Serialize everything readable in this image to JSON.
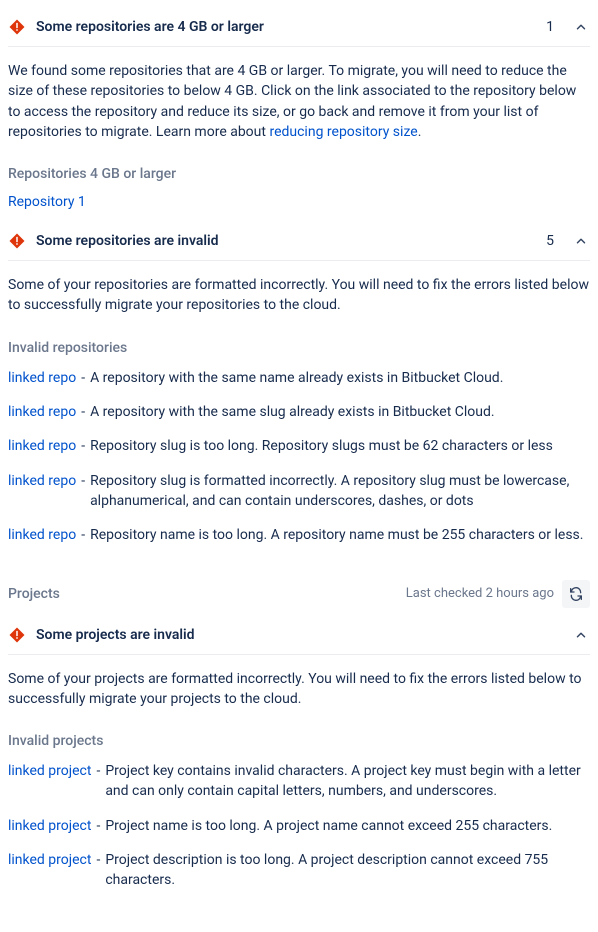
{
  "panel1": {
    "title": "Some repositories are 4 GB or larger",
    "count": "1",
    "description_before_link": "We found some repositories that are 4 GB or larger. To migrate, you will need to reduce the size of these repositories to below 4 GB. Click on the link associated to the repository below to access the repository and reduce its size, or go back and remove it from your list of repositories to migrate. Learn more about ",
    "description_link": "reducing repository size",
    "description_after_link": ".",
    "subheading": "Repositories 4 GB or larger",
    "repo_link": "Repository 1"
  },
  "panel2": {
    "title": "Some repositories are invalid",
    "count": "5",
    "description": "Some of your repositories are formatted incorrectly. You will need to fix the errors listed below to successfully migrate your repositories to the cloud.",
    "subheading": "Invalid repositories",
    "items": [
      {
        "link": "linked repo",
        "desc": "A repository with the same name already exists in Bitbucket Cloud."
      },
      {
        "link": "linked repo",
        "desc": "A repository with the same slug already exists in Bitbucket Cloud."
      },
      {
        "link": "linked repo",
        "desc": "Repository slug is too long. Repository slugs must be 62 characters or less"
      },
      {
        "link": "linked repo",
        "desc": "Repository slug is formatted incorrectly. A repository slug must be lowercase, alphanumerical, and can contain underscores, dashes, or dots"
      },
      {
        "link": "linked repo",
        "desc": "Repository name is too long. A repository name must be 255 characters or less."
      }
    ]
  },
  "projects_section": {
    "title": "Projects",
    "last_checked": "Last checked 2 hours ago"
  },
  "panel3": {
    "title": "Some projects are invalid",
    "description": "Some of your projects are formatted incorrectly. You will need to fix the errors listed below to successfully migrate your projects to the cloud.",
    "subheading": "Invalid projects",
    "items": [
      {
        "link": "linked project",
        "desc": "Project key contains invalid characters. A project key must begin with a letter and can only contain capital letters, numbers, and underscores."
      },
      {
        "link": "linked project",
        "desc": "Project name is too long. A project name cannot exceed 255 characters."
      },
      {
        "link": "linked project",
        "desc": "Project description is too long. A project description cannot exceed 755 characters."
      }
    ]
  }
}
